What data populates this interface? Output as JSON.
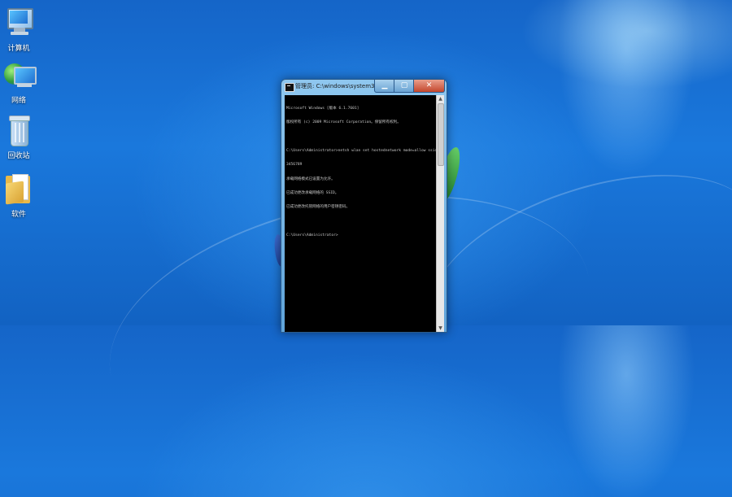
{
  "desktop": {
    "icons": [
      {
        "label": "计算机",
        "icon": "computer-icon"
      },
      {
        "label": "网络",
        "icon": "network-icon"
      },
      {
        "label": "回收站",
        "icon": "recycle-bin-icon"
      },
      {
        "label": "软件",
        "icon": "folder-icon"
      }
    ]
  },
  "cmd": {
    "title": "管理员: C:\\windows\\system32\\cmd.exe",
    "minimize": "▁",
    "maximize": "▢",
    "close": "✕",
    "lines": [
      "Microsoft Windows [版本 6.1.7601]",
      "版权所有 (c) 2009 Microsoft Corporation。保留所有权利。",
      "",
      "C:\\Users\\Administrator>netsh wlan set hostednetwork mode=allow ssid=ACE-PC key=12",
      "3456789",
      "承载网络模式已设置为允许。",
      "已成功更改承载网络的 SSID。",
      "已成功更改托管网络的用户密钥密码。",
      "",
      "C:\\Users\\Administrator>"
    ]
  },
  "scrollbar": {
    "up": "▲",
    "down": "▼"
  }
}
